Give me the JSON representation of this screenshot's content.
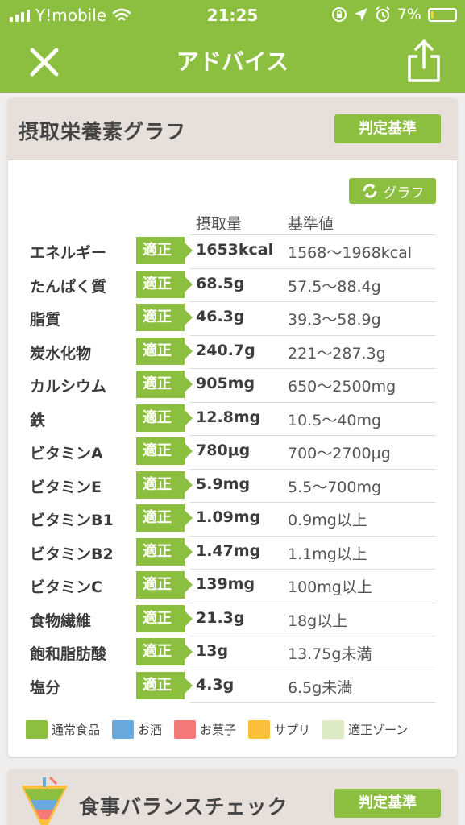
{
  "status": {
    "carrier": "Y!mobile",
    "time": "21:25",
    "battery": "7%",
    "battery_level": 0.07
  },
  "nav": {
    "title": "アドバイス",
    "close_icon": "close-icon",
    "share_icon": "share-icon"
  },
  "nutrient_card": {
    "title": "摂取栄養素グラフ",
    "judge_label": "判定基準",
    "graph_label": "グラフ",
    "col_intake": "摂取量",
    "col_reference": "基準値",
    "rows": [
      {
        "name": "エネルギー",
        "status": "適正",
        "intake": "1653kcal",
        "reference": "1568〜1968kcal"
      },
      {
        "name": "たんぱく質",
        "status": "適正",
        "intake": "68.5g",
        "reference": "57.5〜88.4g"
      },
      {
        "name": "脂質",
        "status": "適正",
        "intake": "46.3g",
        "reference": "39.3〜58.9g"
      },
      {
        "name": "炭水化物",
        "status": "適正",
        "intake": "240.7g",
        "reference": "221〜287.3g"
      },
      {
        "name": "カルシウム",
        "status": "適正",
        "intake": "905mg",
        "reference": "650〜2500mg"
      },
      {
        "name": "鉄",
        "status": "適正",
        "intake": "12.8mg",
        "reference": "10.5〜40mg"
      },
      {
        "name": "ビタミンA",
        "status": "適正",
        "intake": "780μg",
        "reference": "700〜2700μg"
      },
      {
        "name": "ビタミンE",
        "status": "適正",
        "intake": "5.9mg",
        "reference": "5.5〜700mg"
      },
      {
        "name": "ビタミンB1",
        "status": "適正",
        "intake": "1.09mg",
        "reference": "0.9mg以上"
      },
      {
        "name": "ビタミンB2",
        "status": "適正",
        "intake": "1.47mg",
        "reference": "1.1mg以上"
      },
      {
        "name": "ビタミンC",
        "status": "適正",
        "intake": "139mg",
        "reference": "100mg以上"
      },
      {
        "name": "食物繊維",
        "status": "適正",
        "intake": "21.3g",
        "reference": "18g以上"
      },
      {
        "name": "飽和脂肪酸",
        "status": "適正",
        "intake": "13g",
        "reference": "13.75g未満"
      },
      {
        "name": "塩分",
        "status": "適正",
        "intake": "4.3g",
        "reference": "6.5g未満"
      }
    ],
    "legend": [
      {
        "label": "通常食品",
        "color": "#8cbf3f"
      },
      {
        "label": "お酒",
        "color": "#6aa9dc"
      },
      {
        "label": "お菓子",
        "color": "#f47a7a"
      },
      {
        "label": "サプリ",
        "color": "#fbbf3a"
      },
      {
        "label": "適正ゾーン",
        "color": "#dcebc6"
      }
    ]
  },
  "balance_card": {
    "title": "食事バランスチェック",
    "judge_label": "判定基準"
  },
  "colors": {
    "accent": "#8cbf3f",
    "card_header": "#e7e0da"
  }
}
